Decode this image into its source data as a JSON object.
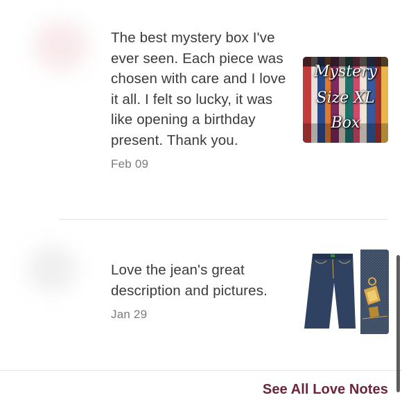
{
  "reviews": [
    {
      "text": "The best mystery box I've ever seen. Each piece was chosen with care and I love it all. I felt so lucky, it was like opening a birthday present. Thank you.",
      "date": "Feb 09",
      "thumbnail": {
        "icon": "mystery-box-photo",
        "lines": [
          "Mystery",
          "Size XL",
          "Box"
        ]
      }
    },
    {
      "text": "Love the jean's great description and pictures.",
      "date": "Jan 29",
      "thumbnail": {
        "icon": "jeans-photo"
      }
    }
  ],
  "footer": {
    "see_all_label": "See All Love Notes"
  },
  "colors": {
    "accent": "#6b2438",
    "body_text": "#3a3a3a",
    "date_text": "#7a7a7a",
    "divider": "#e4e4e4"
  }
}
